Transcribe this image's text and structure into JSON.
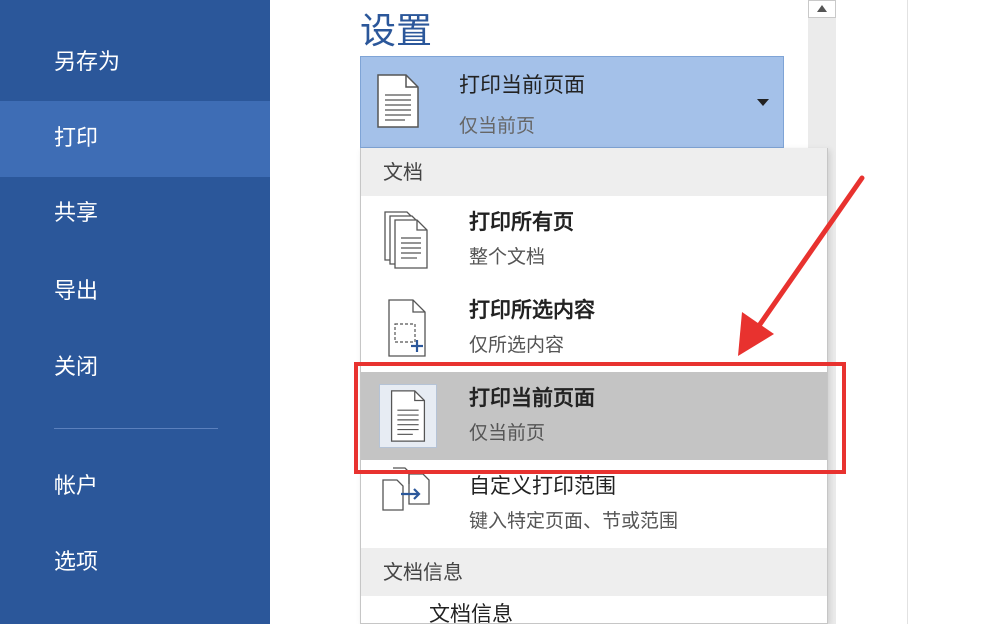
{
  "sidebar": {
    "items": [
      {
        "label": "另存为"
      },
      {
        "label": "打印",
        "active": true
      },
      {
        "label": "共享"
      },
      {
        "label": "导出"
      },
      {
        "label": "关闭"
      },
      {
        "label": "帐户"
      },
      {
        "label": "选项"
      }
    ]
  },
  "settings": {
    "title": "设置",
    "selected": {
      "title": "打印当前页面",
      "subtitle": "仅当前页",
      "icon": "single-page-icon"
    }
  },
  "menu": {
    "section1": "文档",
    "items": [
      {
        "title": "打印所有页",
        "subtitle": "整个文档",
        "icon": "all-pages-icon"
      },
      {
        "title": "打印所选内容",
        "subtitle": "仅所选内容",
        "icon": "selection-icon"
      },
      {
        "title": "打印当前页面",
        "subtitle": "仅当前页",
        "icon": "current-page-icon",
        "highlighted": true
      },
      {
        "title": "自定义打印范围",
        "subtitle": "键入特定页面、节或范围",
        "icon": "custom-range-icon"
      }
    ],
    "section2": "文档信息",
    "sub_item": "文档信息"
  },
  "colors": {
    "sidebar": "#2b579a",
    "sidebar_active": "#3e6db5",
    "dropdown": "#a4c1e9",
    "highlight": "#c4c4c4",
    "annotation": "#e8322f"
  }
}
